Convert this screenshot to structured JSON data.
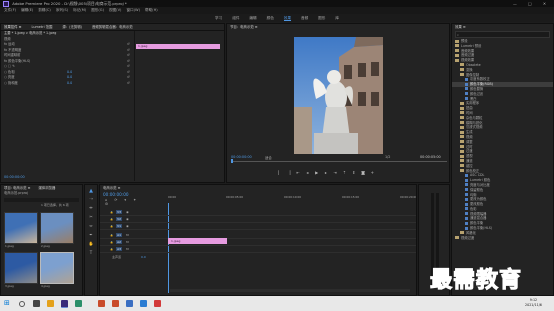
{
  "window": {
    "title": "Adobe Premiere Pro 2020 - D:\\视频\\005\\项目\\电商示范.prproj *"
  },
  "menu": [
    "文件(F)",
    "编辑(E)",
    "剪辑(C)",
    "序列(S)",
    "标记(M)",
    "图形(G)",
    "视图(V)",
    "窗口(W)",
    "帮助(H)"
  ],
  "workspaces": {
    "items": [
      "学习",
      "组件",
      "编辑",
      "颜色",
      "效果",
      "音频",
      "图形",
      "库"
    ],
    "active": "效果"
  },
  "effect_controls": {
    "tabs": [
      "效果控件 ≡",
      "Lumetri 范围",
      "源：(无剪辑)",
      "音频剪辑混合器：电商示范"
    ],
    "header": "主要 * 1.jpeg ∨ 电商示范 * 1.jpeg",
    "clip_label": "1.jpeg",
    "section_video": "视频",
    "rows": [
      {
        "label": "fx 运动"
      },
      {
        "label": "fx 不透明度"
      },
      {
        "label": "   时间重映射"
      },
      {
        "label": "fx 颜色平衡(HLS)"
      },
      {
        "label": "   ○ □ ✎"
      },
      {
        "label": "  ○ 色相",
        "value": "0.0"
      },
      {
        "label": "  ○ 亮度",
        "value": "0.0"
      },
      {
        "label": "  ○ 饱和度",
        "value": "0.0"
      }
    ],
    "timecode": "00:00:00:00"
  },
  "program_monitor": {
    "tab": "节目：电商示范 ≡",
    "timecode_left": "00:00:00:00",
    "fit": "适合",
    "fraction": "1/2",
    "timecode_right": "00:00:05:00"
  },
  "effects_panel": {
    "tab": "效果 ≡",
    "items": [
      {
        "label": "预设",
        "type": "folder",
        "indent": 0
      },
      {
        "label": "Lumetri 预设",
        "type": "folder",
        "indent": 0
      },
      {
        "label": "音频效果",
        "type": "folder",
        "indent": 0
      },
      {
        "label": "音频过渡",
        "type": "folder",
        "indent": 0
      },
      {
        "label": "视频效果",
        "type": "folder",
        "indent": 0
      },
      {
        "label": "Obsolete",
        "type": "folder",
        "indent": 1
      },
      {
        "label": "变换",
        "type": "folder",
        "indent": 1
      },
      {
        "label": "图像控制",
        "type": "folder",
        "indent": 1
      },
      {
        "label": "灰度系数校正",
        "type": "preset",
        "indent": 2
      },
      {
        "label": "颜色平衡(RGB)",
        "type": "preset",
        "indent": 2,
        "selected": true
      },
      {
        "label": "颜色替换",
        "type": "preset",
        "indent": 2
      },
      {
        "label": "颜色过滤",
        "type": "preset",
        "indent": 2
      },
      {
        "label": "黑白",
        "type": "preset",
        "indent": 2
      },
      {
        "label": "实用程序",
        "type": "folder",
        "indent": 1
      },
      {
        "label": "扭曲",
        "type": "folder",
        "indent": 1
      },
      {
        "label": "时间",
        "type": "folder",
        "indent": 1
      },
      {
        "label": "杂色与颗粒",
        "type": "folder",
        "indent": 1
      },
      {
        "label": "模糊与锐化",
        "type": "folder",
        "indent": 1
      },
      {
        "label": "沉浸式视频",
        "type": "folder",
        "indent": 1
      },
      {
        "label": "生成",
        "type": "folder",
        "indent": 1
      },
      {
        "label": "视频",
        "type": "folder",
        "indent": 1
      },
      {
        "label": "调整",
        "type": "folder",
        "indent": 1
      },
      {
        "label": "过时",
        "type": "folder",
        "indent": 1
      },
      {
        "label": "过渡",
        "type": "folder",
        "indent": 1
      },
      {
        "label": "透视",
        "type": "folder",
        "indent": 1
      },
      {
        "label": "通道",
        "type": "folder",
        "indent": 1
      },
      {
        "label": "键控",
        "type": "folder",
        "indent": 1
      },
      {
        "label": "颜色校正",
        "type": "folder",
        "indent": 1
      },
      {
        "label": "ASC CDL",
        "type": "preset",
        "indent": 2
      },
      {
        "label": "Lumetri 颜色",
        "type": "preset",
        "indent": 2
      },
      {
        "label": "亮度与对比度",
        "type": "preset",
        "indent": 2
      },
      {
        "label": "保留颜色",
        "type": "preset",
        "indent": 2
      },
      {
        "label": "均衡",
        "type": "preset",
        "indent": 2
      },
      {
        "label": "更改为颜色",
        "type": "preset",
        "indent": 2
      },
      {
        "label": "更改颜色",
        "type": "preset",
        "indent": 2
      },
      {
        "label": "色彩",
        "type": "preset",
        "indent": 2
      },
      {
        "label": "视频限幅器",
        "type": "preset",
        "indent": 2
      },
      {
        "label": "通道混合器",
        "type": "preset",
        "indent": 2
      },
      {
        "label": "颜色平衡",
        "type": "preset",
        "indent": 2
      },
      {
        "label": "颜色平衡(HLS)",
        "type": "preset",
        "indent": 2
      },
      {
        "label": "风格化",
        "type": "folder",
        "indent": 1
      },
      {
        "label": "视频过渡",
        "type": "folder",
        "indent": 0
      }
    ]
  },
  "project_panel": {
    "tabs": [
      "项目: 电商示范 ≡",
      "媒体浏览器"
    ],
    "path": "电商示范.prproj",
    "count": "1 项已选择，共 6 项",
    "thumbs": [
      {
        "label": "1.jpeg"
      },
      {
        "label": "2.jpeg"
      },
      {
        "label": "3.jpeg"
      },
      {
        "label": "4.jpeg"
      }
    ]
  },
  "timeline": {
    "tab": "电商示范 ≡",
    "timecode": "00:00:00:00",
    "ruler": [
      "00:00",
      "00:00:05:00",
      "00:00:10:00",
      "00:00:15:00",
      "00:00:20:00"
    ],
    "tracks": [
      "V3",
      "V2",
      "V1",
      "A1",
      "A2",
      "A3"
    ],
    "master": "主声道",
    "master_value": "0.0",
    "clip_label": "1.jpeg"
  },
  "taskbar": {
    "time": "9:12",
    "date": "2021/11/6"
  },
  "watermark": "最需教育",
  "colors": {
    "accent": "#4f97e3",
    "clip": "#e69be0",
    "panel": "#232323"
  }
}
